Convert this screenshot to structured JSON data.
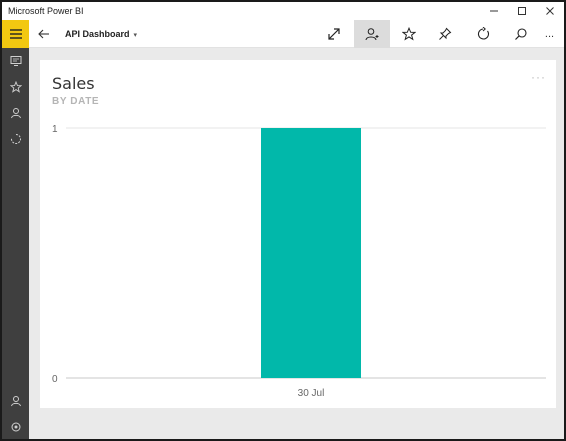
{
  "window": {
    "title": "Microsoft Power BI",
    "controls": [
      "minimize",
      "maximize",
      "close"
    ]
  },
  "sidebar": {
    "menu_icon": "hamburger-icon",
    "items": [
      {
        "icon": "dashboard-icon"
      },
      {
        "icon": "star-icon"
      },
      {
        "icon": "person-icon"
      },
      {
        "icon": "recent-icon"
      }
    ],
    "bottom_items": [
      {
        "icon": "account-icon"
      },
      {
        "icon": "settings-icon"
      }
    ]
  },
  "commandbar": {
    "dashboard_title": "API Dashboard",
    "tools": [
      "expand-icon",
      "share-icon",
      "favorite-icon",
      "pin-icon",
      "refresh-icon",
      "search-icon",
      "more-icon"
    ],
    "more_label": "..."
  },
  "tile": {
    "title": "Sales",
    "subtitle": "BY DATE",
    "more_label": "···"
  },
  "colors": {
    "accent": "#f2c811",
    "bar": "#01b8aa",
    "sidebar": "#3f3f3f"
  },
  "chart_data": {
    "type": "bar",
    "title": "Sales",
    "subtitle": "BY DATE",
    "categories": [
      "30 Jul"
    ],
    "values": [
      1
    ],
    "ylim": [
      0,
      1
    ],
    "yticks": [
      0,
      1
    ],
    "grid": true,
    "legend": "none"
  }
}
